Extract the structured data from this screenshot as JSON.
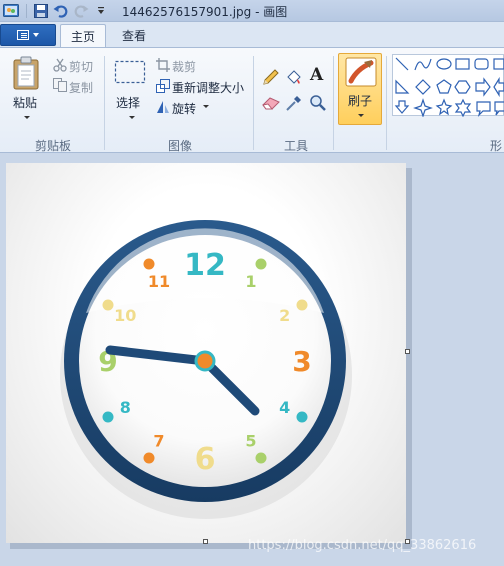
{
  "window": {
    "title": "14462576157901.jpg - 画图"
  },
  "tabs": [
    {
      "label": "主页",
      "active": true
    },
    {
      "label": "查看",
      "active": false
    }
  ],
  "clipboard": {
    "paste_label": "粘贴",
    "cut_label": "剪切",
    "copy_label": "复制",
    "group_label": "剪贴板"
  },
  "image": {
    "select_label": "选择",
    "crop_label": "裁剪",
    "resize_label": "重新调整大小",
    "rotate_label": "旋转",
    "group_label": "图像"
  },
  "tools": {
    "group_label": "工具",
    "items": [
      "pencil-icon",
      "fill-icon",
      "text-icon",
      "eraser-icon",
      "color-picker-icon",
      "magnifier-icon"
    ]
  },
  "brushes": {
    "label": "刷子"
  },
  "shapes": {
    "group_label": "形"
  },
  "clock": {
    "numerals": [
      "12",
      "1",
      "2",
      "3",
      "4",
      "5",
      "6",
      "7",
      "8",
      "9",
      "10",
      "11"
    ],
    "colors": {
      "rim": "#1f4a78",
      "teal": "#35b8c4",
      "green": "#a9d06a",
      "orange": "#f08a2a",
      "yellow": "#f0dc8c"
    }
  },
  "watermark": "https://blog.csdn.net/qq_33862616"
}
